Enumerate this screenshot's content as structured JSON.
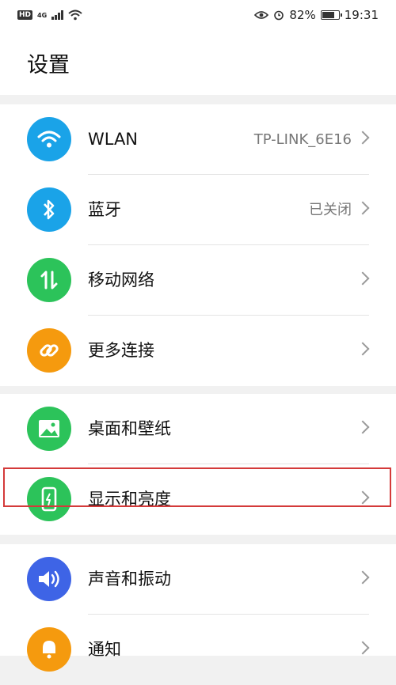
{
  "status_bar": {
    "hd": "HD",
    "network": "4G",
    "battery_percent": "82%",
    "time": "19:31",
    "battery_level": 0.82
  },
  "header": {
    "title": "设置"
  },
  "groups": [
    {
      "items": [
        {
          "label": "WLAN",
          "value": "TP-LINK_6E16",
          "icon": "wifi-icon",
          "color": "#1aa3e8"
        },
        {
          "label": "蓝牙",
          "value": "已关闭",
          "icon": "bluetooth-icon",
          "color": "#1aa3e8"
        },
        {
          "label": "移动网络",
          "value": "",
          "icon": "mobile-data-icon",
          "color": "#2cc35a"
        },
        {
          "label": "更多连接",
          "value": "",
          "icon": "link-icon",
          "color": "#f59a0e"
        }
      ]
    },
    {
      "items": [
        {
          "label": "桌面和壁纸",
          "value": "",
          "icon": "image-icon",
          "color": "#2cc35a"
        },
        {
          "label": "显示和亮度",
          "value": "",
          "icon": "phone-brightness-icon",
          "color": "#2cc35a"
        }
      ]
    },
    {
      "items": [
        {
          "label": "声音和振动",
          "value": "",
          "icon": "speaker-icon",
          "color": "#3e64e6"
        },
        {
          "label": "通知",
          "value": "",
          "icon": "bell-icon",
          "color": "#f59a0e"
        }
      ]
    }
  ],
  "highlight_color": "#d43a3a"
}
